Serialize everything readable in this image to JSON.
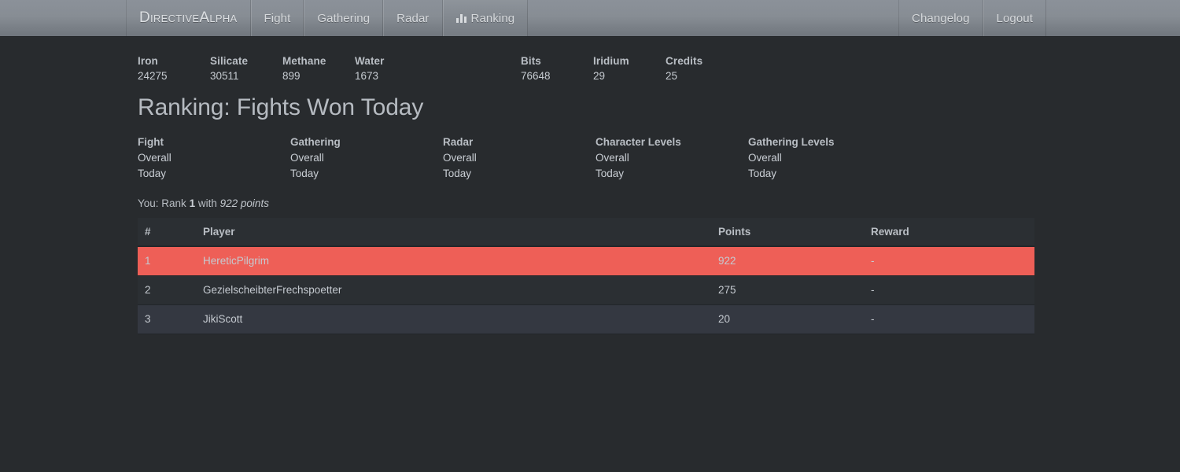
{
  "navbar": {
    "brand": "DirectiveAlpha",
    "left_items": [
      {
        "label": "Fight",
        "icon": null,
        "active": false
      },
      {
        "label": "Gathering",
        "icon": null,
        "active": false
      },
      {
        "label": "Radar",
        "icon": null,
        "active": false
      },
      {
        "label": "Ranking",
        "icon": "bar-chart-icon",
        "active": true
      }
    ],
    "right_items": [
      {
        "label": "Changelog"
      },
      {
        "label": "Logout"
      }
    ]
  },
  "resources": {
    "primary": [
      {
        "name": "Iron",
        "value": "24275"
      },
      {
        "name": "Silicate",
        "value": "30511"
      },
      {
        "name": "Methane",
        "value": "899"
      },
      {
        "name": "Water",
        "value": "1673"
      }
    ],
    "secondary": [
      {
        "name": "Bits",
        "value": "76648"
      },
      {
        "name": "Iridium",
        "value": "29"
      },
      {
        "name": "Credits",
        "value": "25"
      }
    ]
  },
  "page": {
    "title": "Ranking: Fights Won Today"
  },
  "categories": [
    {
      "title": "Fight",
      "links": [
        "Overall",
        "Today"
      ]
    },
    {
      "title": "Gathering",
      "links": [
        "Overall",
        "Today"
      ]
    },
    {
      "title": "Radar",
      "links": [
        "Overall",
        "Today"
      ]
    },
    {
      "title": "Character Levels",
      "links": [
        "Overall",
        "Today"
      ]
    },
    {
      "title": "Gathering Levels",
      "links": [
        "Overall",
        "Today"
      ]
    }
  ],
  "self_rank": {
    "prefix": "You: Rank",
    "rank": "1",
    "middle": "with",
    "points": "922 points"
  },
  "table": {
    "headers": [
      "#",
      "Player",
      "Points",
      "Reward"
    ],
    "rows": [
      {
        "rank": "1",
        "player": "HereticPilgrim",
        "points": "922",
        "reward": "-",
        "style": "self"
      },
      {
        "rank": "2",
        "player": "GezielscheibterFrechspoetter",
        "points": "275",
        "reward": "-",
        "style": "plain"
      },
      {
        "rank": "3",
        "player": "JikiScott",
        "points": "20",
        "reward": "-",
        "style": "alt"
      }
    ]
  },
  "colors": {
    "navbar_top": "#8b9199",
    "navbar_bottom": "#70767d",
    "body_bg": "#282b2e",
    "table_header_bg": "#2b2f33",
    "row_bg": "#2b2f33",
    "row_alt_bg": "#343841",
    "highlight_row": "#ee5f57",
    "text": "#c5cad0"
  }
}
